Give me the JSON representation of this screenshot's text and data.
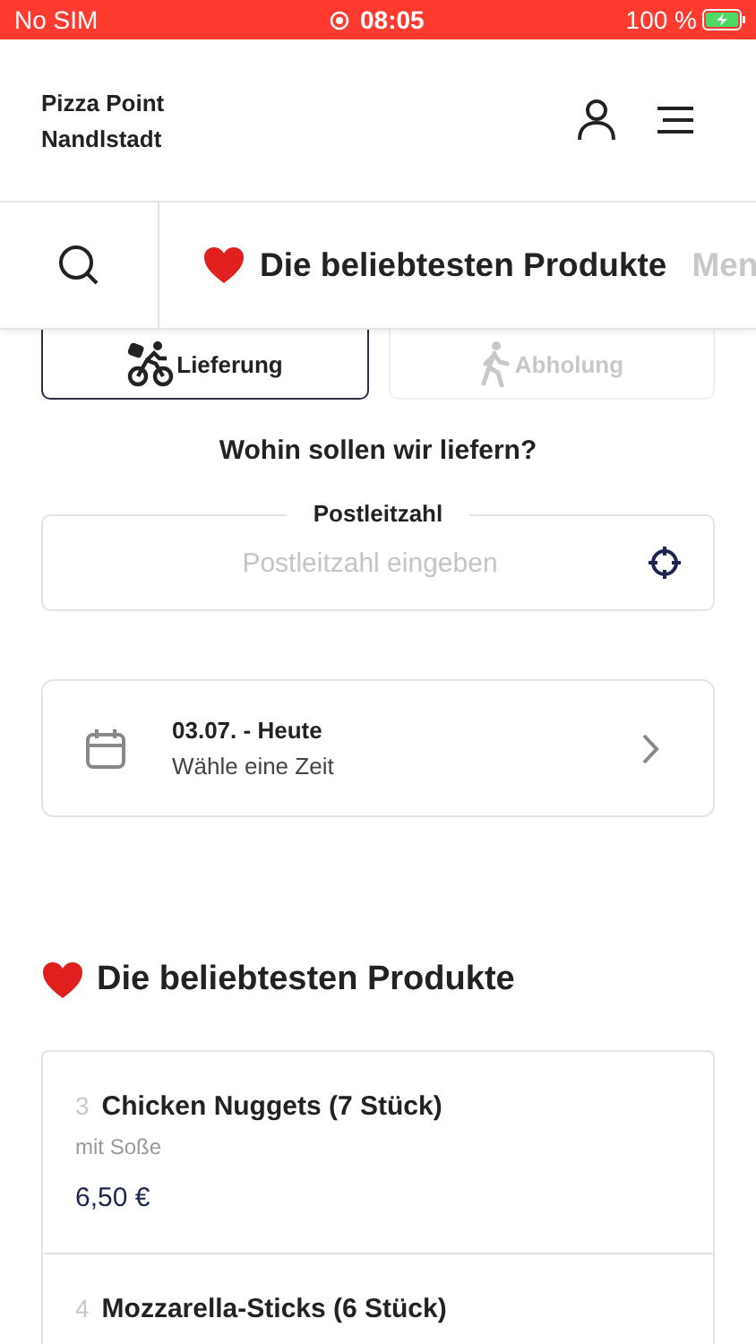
{
  "status_bar": {
    "carrier": "No SIM",
    "time": "08:05",
    "battery": "100 %"
  },
  "header": {
    "shop_name": "Pizza Point",
    "city": "Nandlstadt"
  },
  "category_tabs": [
    {
      "label": "Die beliebtesten Produkte",
      "kind": "heart",
      "selected": true
    },
    {
      "label": "Men",
      "kind": "plain",
      "selected": false
    }
  ],
  "order_modes": [
    {
      "label": "Lieferung",
      "kind": "bike",
      "selected": true
    },
    {
      "label": "Abholung",
      "kind": "walk",
      "selected": false
    }
  ],
  "delivery": {
    "question": "Wohin sollen wir liefern?",
    "field_label": "Postleitzahl",
    "placeholder": "Postleitzahl eingeben"
  },
  "time_picker": {
    "date": "03.07. - Heute",
    "hint": "Wähle eine Zeit"
  },
  "section_title": "Die beliebtesten Produkte",
  "products": [
    {
      "number": "3",
      "name": "Chicken Nuggets (7 Stück)",
      "description": "mit Soße",
      "price": "6,50 €"
    },
    {
      "number": "4",
      "name": "Mozzarella-Sticks (6 Stück)"
    }
  ]
}
